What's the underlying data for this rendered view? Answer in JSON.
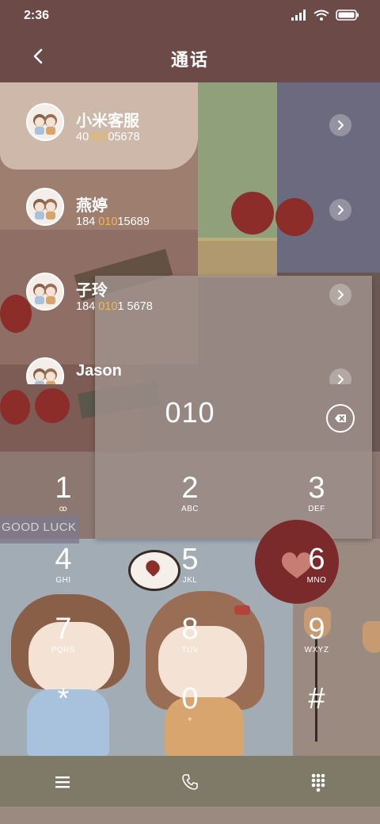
{
  "status": {
    "time": "2:36"
  },
  "header": {
    "title": "通话",
    "back_icon": "chevron-left-icon"
  },
  "contacts": [
    {
      "name": "小米客服",
      "number_pre": "40",
      "number_hl": "010",
      "number_post": "05678"
    },
    {
      "name": "燕婷",
      "number_pre": "184 ",
      "number_hl": "010",
      "number_post": "15689"
    },
    {
      "name": "子玲",
      "number_pre": "184 ",
      "number_hl": "010",
      "number_post": "1 5678"
    },
    {
      "name": "Jason",
      "number_pre": "",
      "number_hl": "",
      "number_post": ""
    }
  ],
  "dialer": {
    "input": "010",
    "keys": [
      {
        "digit": "1",
        "letters": "ꝏ"
      },
      {
        "digit": "2",
        "letters": "ABC"
      },
      {
        "digit": "3",
        "letters": "DEF"
      },
      {
        "digit": "4",
        "letters": "GHI"
      },
      {
        "digit": "5",
        "letters": "JKL"
      },
      {
        "digit": "6",
        "letters": "MNO"
      },
      {
        "digit": "7",
        "letters": "PQRS"
      },
      {
        "digit": "8",
        "letters": "TUV"
      },
      {
        "digit": "9",
        "letters": "WXYZ"
      },
      {
        "digit": "*",
        "letters": ""
      },
      {
        "digit": "0",
        "letters": "+"
      },
      {
        "digit": "#",
        "letters": ""
      }
    ]
  },
  "wallpaper": {
    "sticker_text": "GOOD LUCK"
  },
  "colors": {
    "header": "#6b4a47",
    "highlight": "#f1b94a",
    "call_button": "#7a2a2a",
    "bottom_bar": "#7f7a67"
  },
  "bottom_bar": {
    "icons": [
      "menu-icon",
      "phone-icon",
      "dialpad-icon"
    ]
  }
}
